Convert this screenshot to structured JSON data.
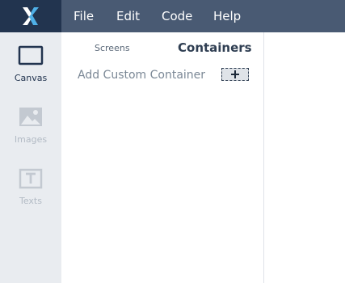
{
  "menu": {
    "items": [
      {
        "label": "File"
      },
      {
        "label": "Edit"
      },
      {
        "label": "Code"
      },
      {
        "label": "Help"
      }
    ]
  },
  "sidebar": {
    "tools": [
      {
        "label": "Canvas",
        "icon": "canvas-icon",
        "state": "active"
      },
      {
        "label": "Images",
        "icon": "image-icon",
        "state": "disabled"
      },
      {
        "label": "Texts",
        "icon": "text-icon",
        "state": "disabled"
      }
    ]
  },
  "panel": {
    "tabs": [
      {
        "label": "Screens",
        "active": false
      },
      {
        "label": "Containers",
        "active": true
      }
    ],
    "add_container_label": "Add Custom Container",
    "add_button_icon": "plus-icon"
  },
  "colors": {
    "topbar": "#495a73",
    "logo_bg": "#22344f",
    "sidebar_bg": "#e9ecf0",
    "accent": "#22344f"
  }
}
